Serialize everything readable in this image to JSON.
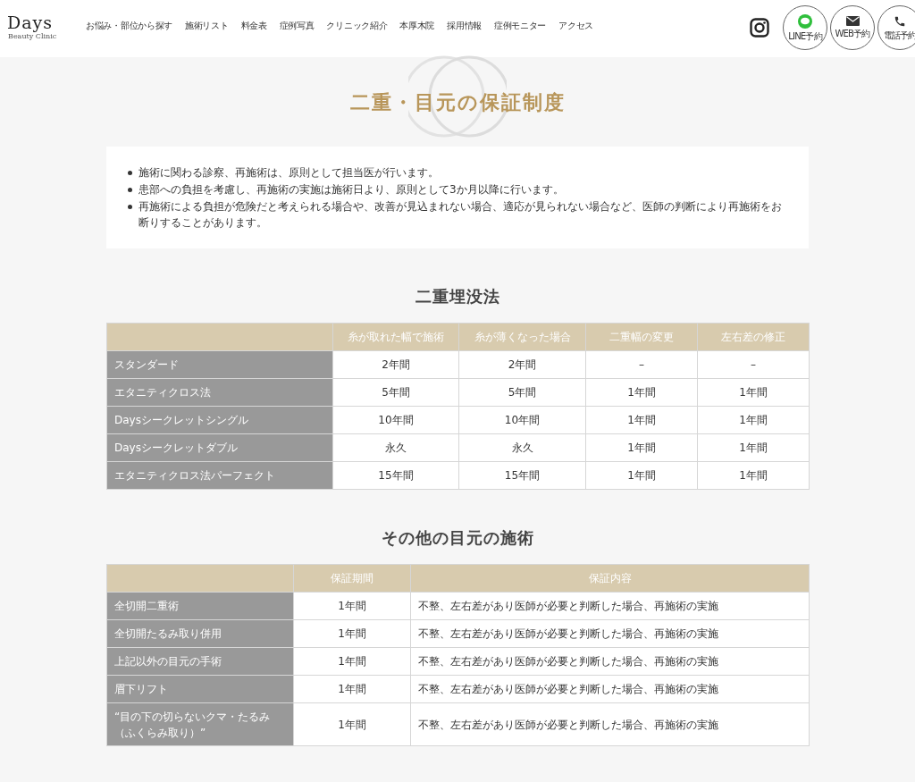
{
  "header": {
    "logo": "Days",
    "logo_sub": "Beauty Clinic",
    "nav": [
      "お悩み・部位から探す",
      "施術リスト",
      "料金表",
      "症例写真",
      "クリニック紹介",
      "本厚木院",
      "採用情報",
      "症例モニター",
      "アクセス"
    ],
    "actions": [
      {
        "kind": "instagram"
      },
      {
        "kind": "line",
        "label": "LINE予約"
      },
      {
        "kind": "web",
        "label": "WEB予約"
      },
      {
        "kind": "phone",
        "label": "電話予約"
      }
    ]
  },
  "title": "二重・目元の保証制度",
  "notes": [
    "施術に関わる診察、再施術は、原則として担当医が行います。",
    "患部への負担を考慮し、再施術の実施は施術日より、原則として3か月以降に行います。",
    "再施術による負担が危険だと考えられる場合や、改善が見込まれない場合、適応が見られない場合など、医師の判断により再施術をお断りすることがあります。"
  ],
  "tables": [
    {
      "heading": "二重埋没法",
      "columns": [
        "糸が取れた幅で施術",
        "糸が薄くなった場合",
        "二重幅の変更",
        "左右差の修正"
      ],
      "rows": [
        {
          "name": "スタンダード",
          "cells": [
            "2年間",
            "2年間",
            "–",
            "–"
          ]
        },
        {
          "name": "エタニティクロス法",
          "cells": [
            "5年間",
            "5年間",
            "1年間",
            "1年間"
          ]
        },
        {
          "name": "Daysシークレットシングル",
          "cells": [
            "10年間",
            "10年間",
            "1年間",
            "1年間"
          ]
        },
        {
          "name": "Daysシークレットダブル",
          "cells": [
            "永久",
            "永久",
            "1年間",
            "1年間"
          ]
        },
        {
          "name": "エタニティクロス法パーフェクト",
          "cells": [
            "15年間",
            "15年間",
            "1年間",
            "1年間"
          ]
        }
      ]
    },
    {
      "heading": "その他の目元の施術",
      "columns": [
        "保証期間",
        "保証内容"
      ],
      "rows": [
        {
          "name": "全切開二重術",
          "cells": [
            "1年間",
            "不整、左右差があり医師が必要と判断した場合、再施術の実施"
          ]
        },
        {
          "name": "全切開たるみ取り併用",
          "cells": [
            "1年間",
            "不整、左右差があり医師が必要と判断した場合、再施術の実施"
          ]
        },
        {
          "name": "上記以外の目元の手術",
          "cells": [
            "1年間",
            "不整、左右差があり医師が必要と判断した場合、再施術の実施"
          ]
        },
        {
          "name": "眉下リフト",
          "cells": [
            "1年間",
            "不整、左右差があり医師が必要と判断した場合、再施術の実施"
          ]
        },
        {
          "name_lines": [
            "“目の下の切らないクマ・たるみ",
            "（ふくらみ取り）”"
          ],
          "cells": [
            "1年間",
            "不整、左右差があり医師が必要と判断した場合、再施術の実施"
          ]
        }
      ]
    }
  ]
}
